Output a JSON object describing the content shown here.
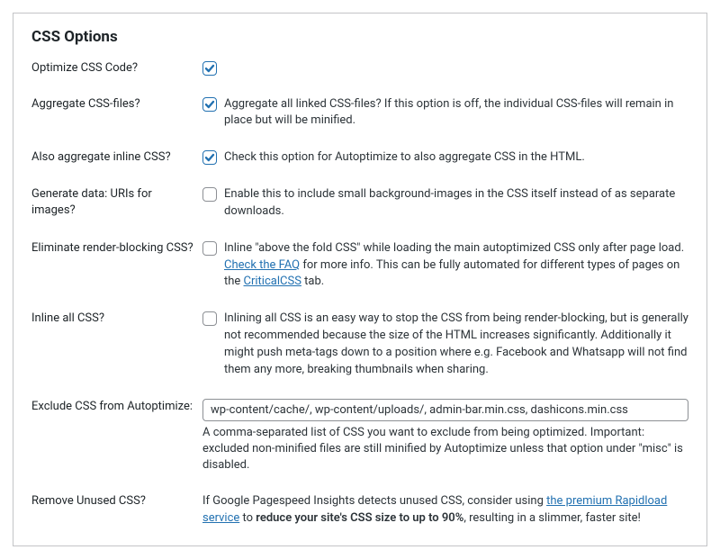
{
  "title": "CSS Options",
  "rows": {
    "optimize": {
      "label": "Optimize CSS Code?",
      "checked": true
    },
    "aggregate": {
      "label": "Aggregate CSS-files?",
      "checked": true,
      "desc": "Aggregate all linked CSS-files? If this option is off, the individual CSS-files will remain in place but will be minified."
    },
    "inline_agg": {
      "label": "Also aggregate inline CSS?",
      "checked": true,
      "desc": "Check this option for Autoptimize to also aggregate CSS in the HTML."
    },
    "datauri": {
      "label": "Generate data: URIs for images?",
      "checked": false,
      "desc": "Enable this to include small background-images in the CSS itself instead of as separate downloads."
    },
    "render_block": {
      "label": "Eliminate render-blocking CSS?",
      "checked": false,
      "pre": "Inline \"above the fold CSS\" while loading the main autoptimized CSS only after page load. ",
      "link1": "Check the FAQ",
      "mid": " for more info. This can be fully automated for different types of pages on the ",
      "link2": "CriticalCSS",
      "post": " tab."
    },
    "inline_all": {
      "label": "Inline all CSS?",
      "checked": false,
      "desc": "Inlining all CSS is an easy way to stop the CSS from being render-blocking, but is generally not recommended because the size of the HTML increases significantly. Additionally it might push meta-tags down to a position where e.g. Facebook and Whatsapp will not find them any more, breaking thumbnails when sharing."
    },
    "exclude": {
      "label": "Exclude CSS from Autoptimize:",
      "value": "wp-content/cache/, wp-content/uploads/, admin-bar.min.css, dashicons.min.css",
      "desc": "A comma-separated list of CSS you want to exclude from being optimized. Important: excluded non-minified files are still minified by Autoptimize unless that option under \"misc\" is disabled."
    },
    "remove_unused": {
      "label": "Remove Unused CSS?",
      "pre": "If Google Pagespeed Insights detects unused CSS, consider using ",
      "link": "the premium Rapidload service",
      "mid": " to ",
      "bold": "reduce your site's CSS size to up to 90%",
      "post": ", resulting in a slimmer, faster site!"
    }
  }
}
